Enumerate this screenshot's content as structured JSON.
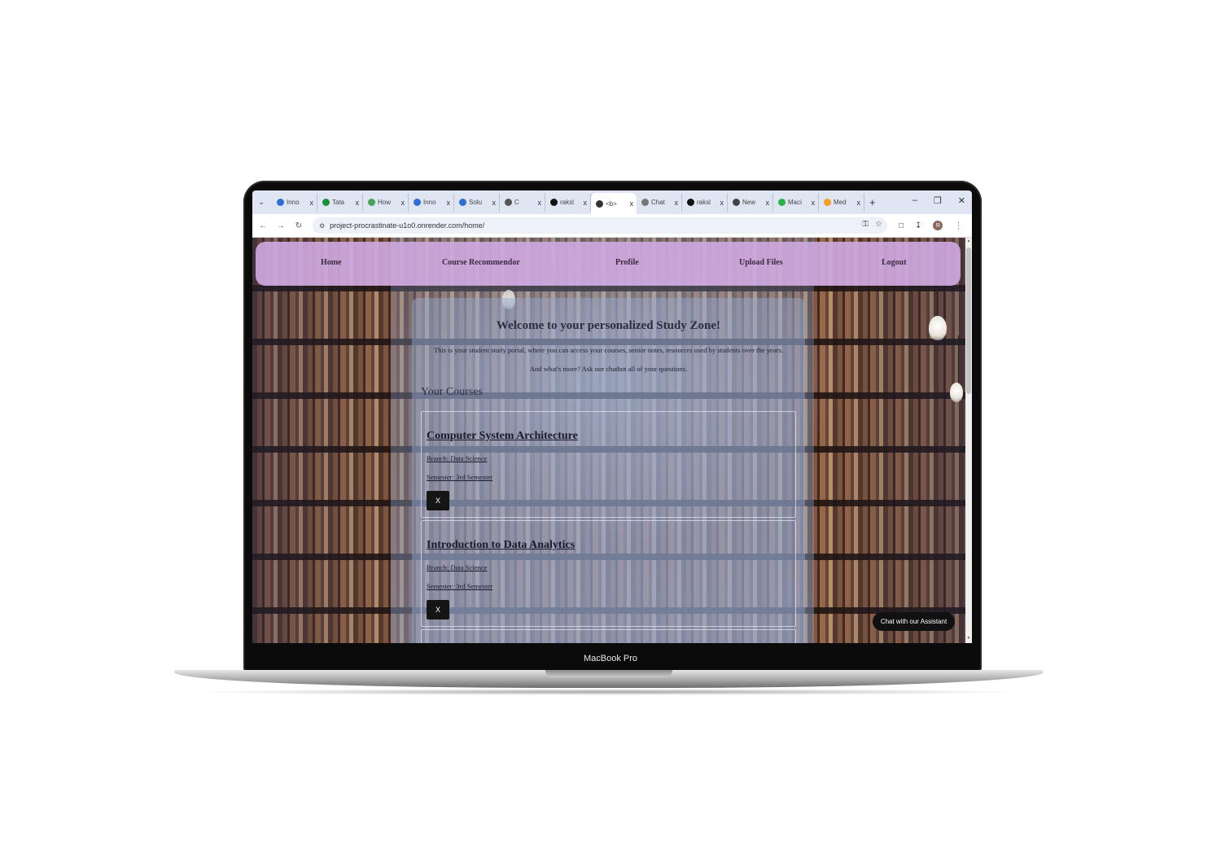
{
  "device": {
    "label": "MacBook Pro"
  },
  "browser": {
    "tabs": [
      {
        "label": "Inno",
        "favicon_color": "#2d6fd6"
      },
      {
        "label": "Tata",
        "favicon_color": "#1b8f3a"
      },
      {
        "label": "How",
        "favicon_color": "#4aa35a"
      },
      {
        "label": "Inno",
        "favicon_color": "#2d6fd6"
      },
      {
        "label": "Solu",
        "favicon_color": "#2d6fd6"
      },
      {
        "label": "C",
        "favicon_color": "#555555"
      },
      {
        "label": "raksl",
        "favicon_color": "#111111"
      },
      {
        "label": "<b>",
        "favicon_color": "#333333"
      },
      {
        "label": "Chat",
        "favicon_color": "#777777"
      },
      {
        "label": "raksl",
        "favicon_color": "#111111"
      },
      {
        "label": "New",
        "favicon_color": "#444444"
      },
      {
        "label": "Maci",
        "favicon_color": "#27b34a"
      },
      {
        "label": "Med",
        "favicon_color": "#f0a020"
      }
    ],
    "active_tab_index": 7,
    "close_glyph": "x",
    "new_tab_glyph": "+",
    "url": "project-procrastinate-u1o0.onrender.com/home/",
    "profile_initial": "R"
  },
  "nav": {
    "items": [
      "Home",
      "Course Recommendor",
      "Profile",
      "Upload Files",
      "Logout"
    ]
  },
  "welcome": {
    "title": "Welcome to your personalized Study Zone!",
    "line1": "This is your student study portal, where you can access your courses, senior notes, resources used by students over the years.",
    "line2": "And what's more? Ask our chatbot all of your questions."
  },
  "courses": {
    "heading": "Your Courses",
    "items": [
      {
        "title": "Computer System Architecture",
        "branch": "Branch: Data Science",
        "semester": "Semester: 3rd Semester",
        "remove_label": "X"
      },
      {
        "title": "Introduction to Data Analytics",
        "branch": "Branch: Data Science",
        "semester": "Semester: 3rd Semester",
        "remove_label": "X"
      }
    ]
  },
  "chat": {
    "label": "Chat with our Assistant"
  },
  "colors": {
    "navbar": "#cda8de",
    "panel": "#96aad2",
    "chat_button": "#111111"
  }
}
